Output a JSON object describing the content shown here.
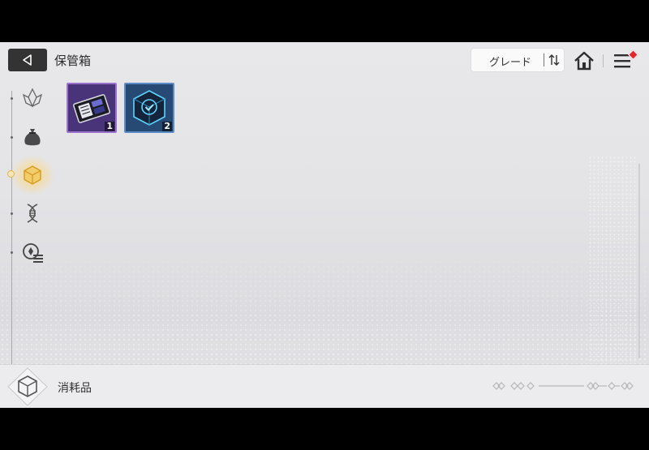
{
  "header": {
    "title": "保管箱",
    "sort_label": "グレード"
  },
  "sidebar": {
    "categories": [
      {
        "icon": "crystal-icon",
        "selected": false
      },
      {
        "icon": "pouch-icon",
        "selected": false
      },
      {
        "icon": "cube-icon",
        "selected": true
      },
      {
        "icon": "dna-icon",
        "selected": false
      },
      {
        "icon": "medal-list-icon",
        "selected": false
      }
    ]
  },
  "items": [
    {
      "icon": "chip-card-icon",
      "count": "1",
      "rarity_color": "#9a72cc"
    },
    {
      "icon": "check-box-icon",
      "count": "2",
      "rarity_color": "#5b8cc8"
    }
  ],
  "footer": {
    "category_label": "消耗品"
  },
  "colors": {
    "accent_gold": "#e1b34b",
    "notify_red": "#e2262e"
  }
}
